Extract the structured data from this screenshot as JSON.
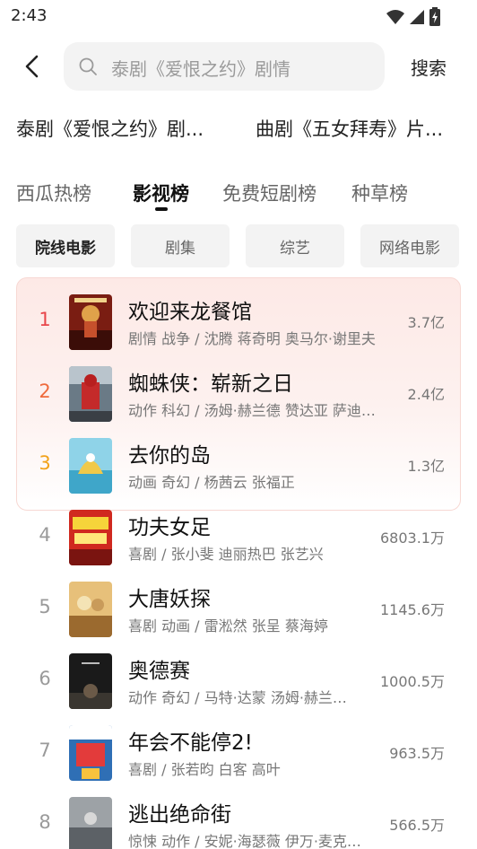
{
  "status_bar": {
    "time": "2:43"
  },
  "search": {
    "query": "泰剧《爱恨之约》剧情",
    "button": "搜索"
  },
  "suggestions": [
    "泰剧《爱恨之约》剧...",
    "曲剧《五女拜寿》片..."
  ],
  "tabs": [
    {
      "label": "西瓜热榜",
      "active": false
    },
    {
      "label": "影视榜",
      "active": true
    },
    {
      "label": "免费短剧榜",
      "active": false
    },
    {
      "label": "种草榜",
      "active": false
    }
  ],
  "chips": [
    {
      "label": "院线电影",
      "active": true
    },
    {
      "label": "剧集",
      "active": false
    },
    {
      "label": "综艺",
      "active": false
    },
    {
      "label": "网络电影",
      "active": false
    }
  ],
  "colors": {
    "rank_1": "#e8464a",
    "rank_2": "#ef6a3c",
    "rank_3": "#f2a21a",
    "rank_default": "#9a9a9a"
  },
  "items": [
    {
      "rank": "1",
      "title": "欢迎来龙餐馆",
      "meta": "剧情 战争 / 沈腾 蒋奇明 奥马尔·谢里夫",
      "value": "3.7亿"
    },
    {
      "rank": "2",
      "title": "蜘蛛侠：崭新之日",
      "meta": "动作 科幻 / 汤姆·赫兰德 赞达亚 萨迪·…",
      "value": "2.4亿"
    },
    {
      "rank": "3",
      "title": "去你的岛",
      "meta": "动画 奇幻 / 杨茜云 张福正",
      "value": "1.3亿"
    },
    {
      "rank": "4",
      "title": "功夫女足",
      "meta": "喜剧 / 张小斐 迪丽热巴 张艺兴",
      "value": "6803.1万"
    },
    {
      "rank": "5",
      "title": "大唐妖探",
      "meta": "喜剧 动画 / 雷淞然 张呈 蔡海婷",
      "value": "1145.6万"
    },
    {
      "rank": "6",
      "title": "奥德赛",
      "meta": "动作 奇幻 / 马特·达蒙 汤姆·赫兰…",
      "value": "1000.5万"
    },
    {
      "rank": "7",
      "title": "年会不能停2!",
      "meta": "喜剧 / 张若昀 白客 高叶",
      "value": "963.5万"
    },
    {
      "rank": "8",
      "title": "逃出绝命街",
      "meta": "惊悚 动作 / 安妮·海瑟薇 伊万·麦克…",
      "value": "566.5万"
    }
  ]
}
